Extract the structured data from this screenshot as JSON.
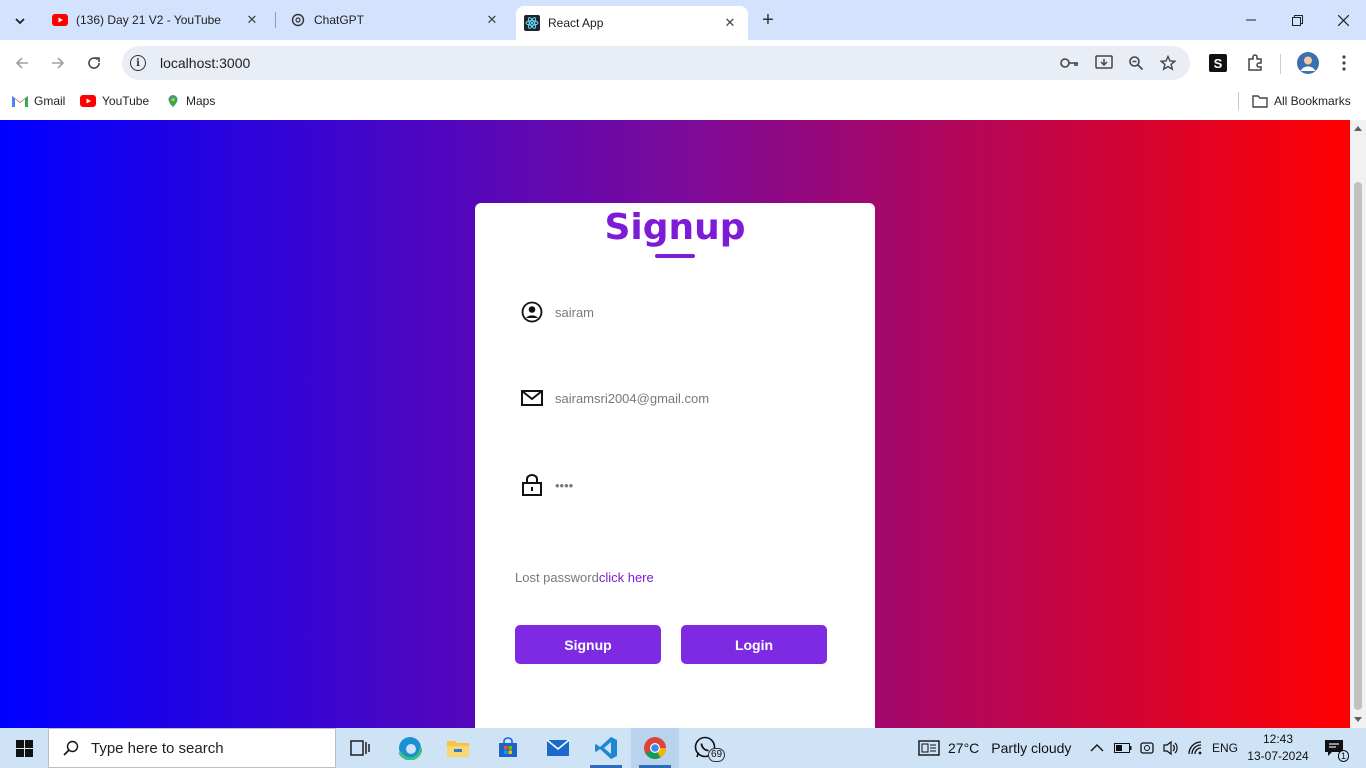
{
  "browser": {
    "tabs": [
      {
        "title": "(136) Day 21 V2 - YouTube",
        "icon": "youtube-icon"
      },
      {
        "title": "ChatGPT",
        "icon": "chatgpt-icon"
      },
      {
        "title": "React App",
        "icon": "react-icon",
        "active": true
      }
    ],
    "url": "localhost:3000",
    "bookmarks": [
      {
        "label": "Gmail",
        "icon": "gmail-icon"
      },
      {
        "label": "YouTube",
        "icon": "youtube-icon"
      },
      {
        "label": "Maps",
        "icon": "maps-icon"
      }
    ],
    "all_bookmarks_label": "All Bookmarks",
    "extension_label": "S"
  },
  "page": {
    "title": "Signup",
    "fields": {
      "name": {
        "value": "sairam",
        "icon": "user-icon"
      },
      "email": {
        "value": "sairamsri2004@gmail.com",
        "icon": "mail-icon"
      },
      "password": {
        "value": "••••",
        "icon": "lock-icon"
      }
    },
    "lost_password": {
      "text": "Lost password",
      "link": "click here"
    },
    "buttons": {
      "signup": "Signup",
      "login": "Login"
    },
    "colors": {
      "accent": "#7e2ae2",
      "gradient_left": "#0000ff",
      "gradient_right": "#ff0000"
    }
  },
  "taskbar": {
    "search_placeholder": "Type here to search",
    "weather": {
      "temp": "27°C",
      "desc": "Partly cloudy"
    },
    "language": "ENG",
    "time": "12:43",
    "date": "13-07-2024",
    "whatsapp_badge": "69",
    "notification_count": "1"
  }
}
